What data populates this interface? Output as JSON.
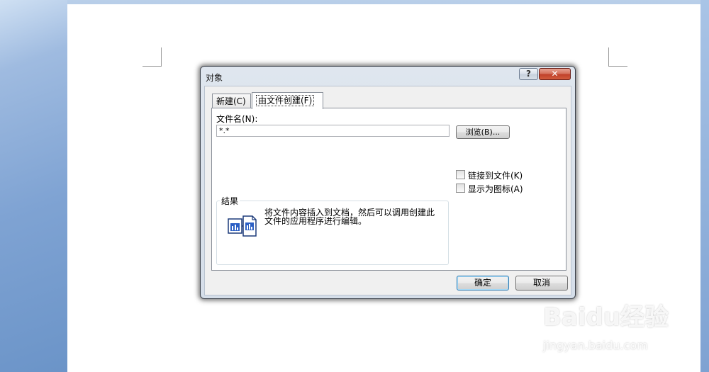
{
  "dialog": {
    "title": "对象",
    "help_label": "?",
    "close_label": "✕",
    "tabs": [
      {
        "label": "新建(C)"
      },
      {
        "label": "由文件创建(F)"
      }
    ],
    "filename_label": "文件名(N):",
    "filename_value": "*.*",
    "browse_label": "浏览(B)...",
    "link_to_file_label": "链接到文件(K)",
    "display_as_icon_label": "显示为图标(A)",
    "result_legend": "结果",
    "result_text": "将文件内容插入到文档，然后可以调用创建此文件的应用程序进行编辑。",
    "ok_label": "确定",
    "cancel_label": "取消"
  },
  "watermark": {
    "logo": "Baidu经验",
    "url": "jingyan.baidu.com"
  }
}
